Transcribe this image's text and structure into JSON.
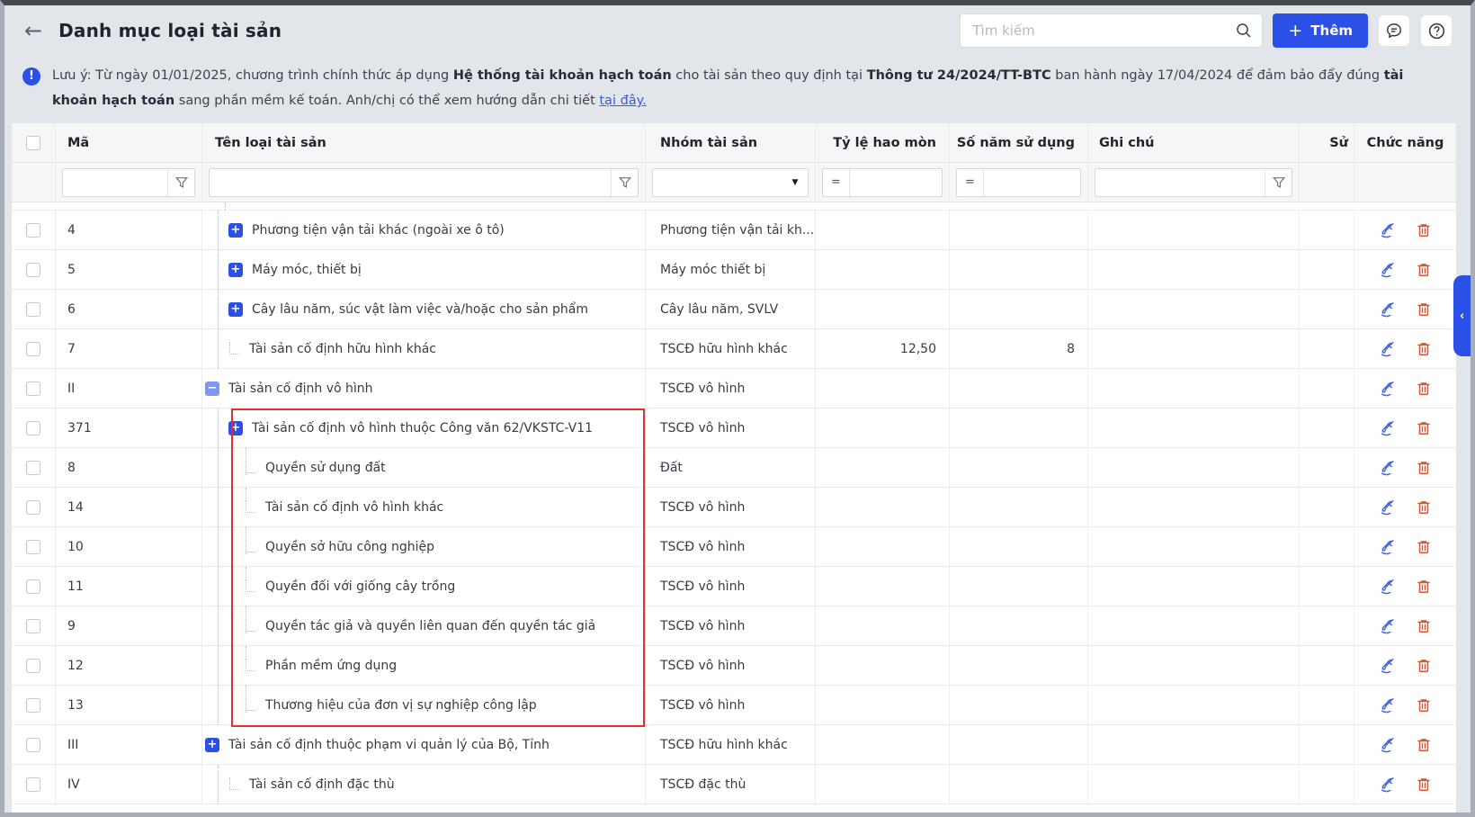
{
  "colors": {
    "accent": "#2b50e8",
    "danger": "#e4512e",
    "highlight_red": "#e22f2f",
    "link": "#3b5bdb"
  },
  "topbar": {
    "back_icon": "←",
    "title": "Danh mục loại tài sản",
    "search_placeholder": "Tìm kiếm",
    "add_plus": "+",
    "add_label": "Thêm",
    "help_glyph": "?"
  },
  "notice": {
    "segments": [
      {
        "t": "Lưu ý: Từ ngày 01/01/2025, chương trình chính thức áp dụng "
      },
      {
        "t": "Hệ thống tài khoản hạch toán",
        "b": true
      },
      {
        "t": " cho tài sản theo quy định tại "
      },
      {
        "t": "Thông tư 24/2024/TT-BTC",
        "b": true
      },
      {
        "t": " ban hành ngày 17/04/2024 để đảm bảo đẩy đúng "
      },
      {
        "t": "tài khoản hạch toán",
        "b": true
      },
      {
        "t": " sang phần mềm kế toán. Anh/chị có thể xem hướng dẫn chi tiết "
      },
      {
        "t": "tại đây.",
        "link": true
      }
    ]
  },
  "table": {
    "columns": [
      {
        "key": "check",
        "label": ""
      },
      {
        "key": "ma",
        "label": "Mã"
      },
      {
        "key": "ten",
        "label": "Tên loại tài sản"
      },
      {
        "key": "nhom",
        "label": "Nhóm tài sản"
      },
      {
        "key": "tyle",
        "label": "Tỷ lệ hao mòn"
      },
      {
        "key": "sonam",
        "label": "Số năm sử dụng"
      },
      {
        "key": "ghichu",
        "label": "Ghi chú"
      },
      {
        "key": "su",
        "label": "Sử"
      },
      {
        "key": "chuc",
        "label": "Chức năng"
      }
    ],
    "filters": {
      "eq": "="
    },
    "icons": {
      "plus": "+",
      "minus": "−",
      "chevron_left": "‹",
      "caret_down": "▼"
    },
    "rows": [
      {
        "ma": "4",
        "level": 1,
        "exp": "plus",
        "leaf": false,
        "hl": false,
        "name": "Phương tiện vận tải khác (ngoài xe ô tô)",
        "group": "Phương tiện vận tải kh...",
        "rate": "",
        "years": "",
        "note": ""
      },
      {
        "ma": "5",
        "level": 1,
        "exp": "plus",
        "leaf": false,
        "hl": false,
        "name": "Máy móc, thiết bị",
        "group": "Máy móc thiết bị",
        "rate": "",
        "years": "",
        "note": ""
      },
      {
        "ma": "6",
        "level": 1,
        "exp": "plus",
        "leaf": false,
        "hl": false,
        "name": "Cây lâu năm, súc vật làm việc và/hoặc cho sản phẩm",
        "group": "Cây lâu năm, SVLV",
        "rate": "",
        "years": "",
        "note": ""
      },
      {
        "ma": "7",
        "level": 1,
        "exp": null,
        "leaf": true,
        "hl": false,
        "name": "Tài sản cố định hữu hình khác",
        "group": "TSCĐ hữu hình khác",
        "rate": "12,50",
        "years": "8",
        "note": ""
      },
      {
        "ma": "II",
        "level": 0,
        "exp": "minus",
        "leaf": false,
        "hl": false,
        "name": "Tài sản cố định vô hình",
        "group": "TSCĐ vô hình",
        "rate": "",
        "years": "",
        "note": ""
      },
      {
        "ma": "371",
        "level": 1,
        "exp": "plus",
        "leaf": false,
        "hl": true,
        "name": "Tài sản cố định vô hình thuộc Công văn 62/VKSTC-V11",
        "group": "TSCĐ vô hình",
        "rate": "",
        "years": "",
        "note": ""
      },
      {
        "ma": "8",
        "level": 2,
        "exp": null,
        "leaf": true,
        "hl": true,
        "name": "Quyền sử dụng đất",
        "group": "Đất",
        "rate": "",
        "years": "",
        "note": ""
      },
      {
        "ma": "14",
        "level": 2,
        "exp": null,
        "leaf": true,
        "hl": true,
        "name": "Tài sản cố định vô hình khác",
        "group": "TSCĐ vô hình",
        "rate": "",
        "years": "",
        "note": ""
      },
      {
        "ma": "10",
        "level": 2,
        "exp": null,
        "leaf": true,
        "hl": true,
        "name": "Quyền sở hữu công nghiệp",
        "group": "TSCĐ vô hình",
        "rate": "",
        "years": "",
        "note": ""
      },
      {
        "ma": "11",
        "level": 2,
        "exp": null,
        "leaf": true,
        "hl": true,
        "name": "Quyền đối với giống cây trồng",
        "group": "TSCĐ vô hình",
        "rate": "",
        "years": "",
        "note": ""
      },
      {
        "ma": "9",
        "level": 2,
        "exp": null,
        "leaf": true,
        "hl": true,
        "name": "Quyền tác giả và quyền liên quan đến quyền tác giả",
        "group": "TSCĐ vô hình",
        "rate": "",
        "years": "",
        "note": ""
      },
      {
        "ma": "12",
        "level": 2,
        "exp": null,
        "leaf": true,
        "hl": true,
        "name": "Phần mềm ứng dụng",
        "group": "TSCĐ vô hình",
        "rate": "",
        "years": "",
        "note": ""
      },
      {
        "ma": "13",
        "level": 2,
        "exp": null,
        "leaf": true,
        "hl": true,
        "name": "Thương hiệu của đơn vị sự nghiệp công lập",
        "group": "TSCĐ vô hình",
        "rate": "",
        "years": "",
        "note": ""
      },
      {
        "ma": "III",
        "level": 0,
        "exp": "plus",
        "leaf": false,
        "hl": false,
        "name": "Tài sản cố định thuộc phạm vi quản lý của Bộ, Tỉnh",
        "group": "TSCĐ hữu hình khác",
        "rate": "",
        "years": "",
        "note": ""
      },
      {
        "ma": "IV",
        "level": 1,
        "exp": null,
        "leaf": true,
        "hl": false,
        "name": "Tài sản cố định đặc thù",
        "group": "TSCĐ đặc thù",
        "rate": "",
        "years": "",
        "note": ""
      }
    ]
  }
}
